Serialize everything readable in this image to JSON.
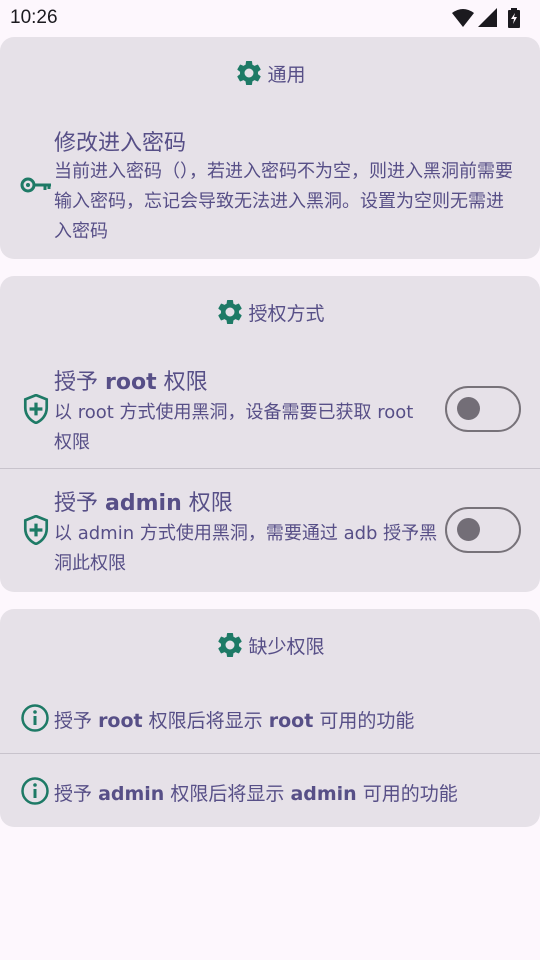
{
  "status_bar": {
    "time": "10:26",
    "icons": [
      "wifi-icon",
      "signal-icon",
      "battery-charging-icon"
    ]
  },
  "colors": {
    "accent": "#1e7a66",
    "text": "#574f87",
    "card": "#e6e1e8",
    "background": "#fdf7fd"
  },
  "general": {
    "header": "通用",
    "change_password": {
      "title": "修改进入密码",
      "desc": "当前进入密码（），若进入密码不为空，则进入黑洞前需要输入密码，忘记会导致无法进入黑洞。设置为空则无需进入密码"
    }
  },
  "auth": {
    "header": "授权方式",
    "root": {
      "title_prefix": "授予",
      "title_keyword": "root",
      "title_suffix": "权限",
      "desc": "以 root 方式使用黑洞，设备需要已获取 root 权限",
      "enabled": false
    },
    "admin": {
      "title_prefix": "授予",
      "title_keyword": "admin",
      "title_suffix": "权限",
      "desc": "以 admin 方式使用黑洞，需要通过 adb 授予黑洞此权限",
      "enabled": false
    }
  },
  "missing": {
    "header": "缺少权限",
    "root_info": {
      "prefix": "授予",
      "keyword": "root",
      "middle": "权限后将显示",
      "keyword2": "root",
      "suffix": "可用的功能"
    },
    "admin_info": {
      "prefix": "授予",
      "keyword": "admin",
      "middle": "权限后将显示",
      "keyword2": "admin",
      "suffix": "可用的功能"
    }
  }
}
